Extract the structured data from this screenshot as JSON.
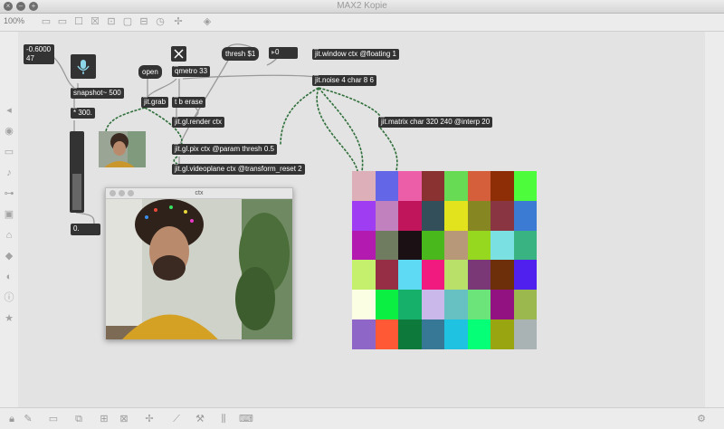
{
  "window": {
    "title": "MAX2 Kopie",
    "zoom": "100%"
  },
  "objects": {
    "float_display": {
      "line1": "-0.6000",
      "line2": "47"
    },
    "open": "open",
    "qmetro": "qmetro 33",
    "thresh_msg": "thresh $1",
    "thresh_num": "0",
    "window": "jit.window ctx @floating 1",
    "noise": "jit.noise 4 char 8 6",
    "snapshot": "snapshot~ 500",
    "mult": "* 300.",
    "grab": "jit.grab",
    "erase": "t b erase",
    "render": "jit.gl.render ctx",
    "pix": "jit.gl.pix ctx @param thresh 0.5",
    "videoplane": "jit.gl.videoplane ctx @transform_reset 2",
    "matrix": "jit.matrix char 320 240 @interp 20",
    "output_num": "0."
  },
  "ctx_window": {
    "title": "ctx"
  },
  "noise_grid": [
    [
      "#ddb0b9",
      "#6366e6",
      "#ec5fa8",
      "#8a3232",
      "#67db53",
      "#d55f3a",
      "#8d2e06",
      "#4dfc3a"
    ],
    [
      "#9e3df2",
      "#c181bf",
      "#c0155a",
      "#33505a",
      "#e3e31d",
      "#868622",
      "#893542",
      "#3c7bd4"
    ],
    [
      "#b31ab0",
      "#6f7c5f",
      "#1b1013",
      "#48b81d",
      "#b79979",
      "#96d71f",
      "#7ae0e2",
      "#3ab383"
    ],
    [
      "#c5f06d",
      "#962e46",
      "#5edaf5",
      "#f11a7e",
      "#b9e16a",
      "#7a3976",
      "#6d2f0a",
      "#5020ee"
    ],
    [
      "#fcfee3",
      "#0bef42",
      "#17b06a",
      "#c9b8e9",
      "#67c1c2",
      "#6ce47a",
      "#911280",
      "#9ab84e"
    ],
    [
      "#8d66c7",
      "#ff5a35",
      "#0d7a3c",
      "#367896",
      "#1fc3e1",
      "#05ff77",
      "#99a611",
      "#a9b3b3"
    ]
  ],
  "icons": {
    "left": [
      "arrow-icon",
      "color-icon",
      "palette-icon",
      "music-icon",
      "dsp-icon",
      "image-icon",
      "tag-icon",
      "bpatcher-icon",
      "snippet-icon",
      "info-icon",
      "star-icon"
    ],
    "bottom": [
      "lock-icon",
      "edit-icon",
      "comment-icon",
      "presentation-icon",
      "grid-icon",
      "add-object-icon",
      "wrench-icon",
      "piano-icon",
      "keyboard-icon",
      "settings-icon"
    ]
  }
}
